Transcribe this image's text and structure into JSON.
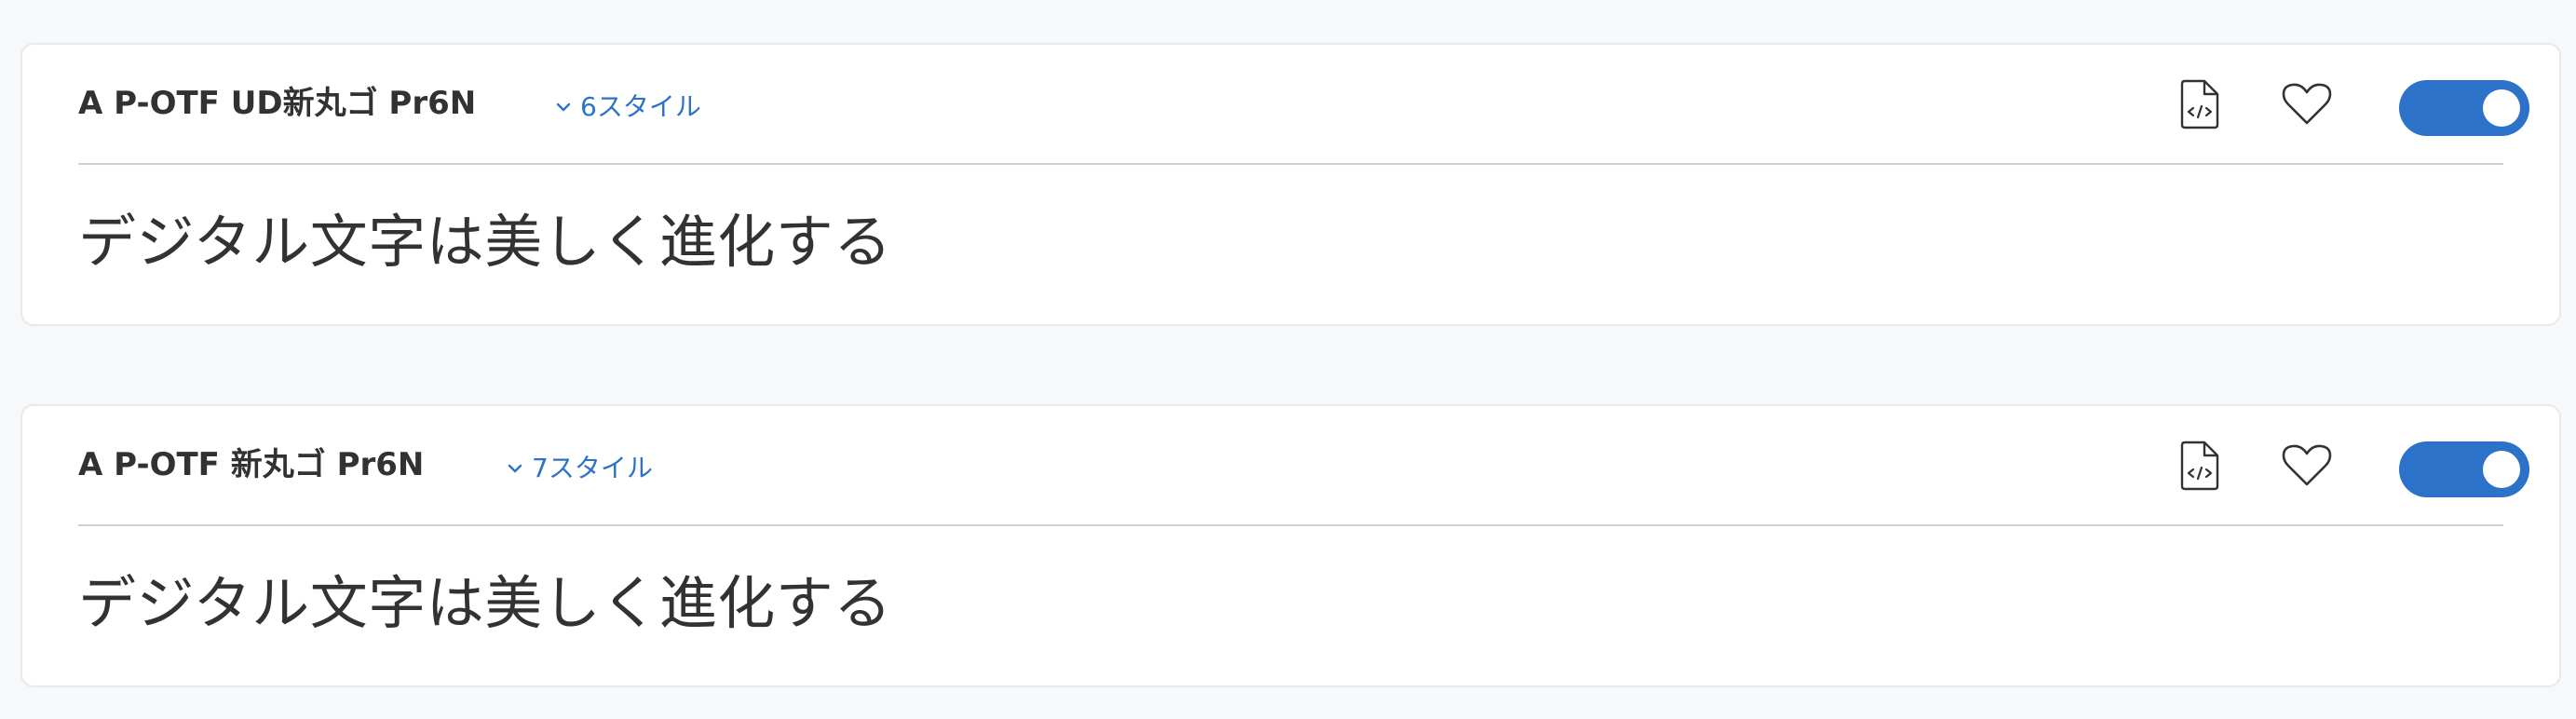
{
  "fonts": [
    {
      "name": "A P-OTF UD新丸ゴ Pr6N",
      "styles_label": "6スタイル",
      "sample_text": "デジタル文字は美しく進化する",
      "enabled": true
    },
    {
      "name": "A P-OTF 新丸ゴ Pr6N",
      "styles_label": "7スタイル",
      "sample_text": "デジタル文字は美しく進化する",
      "enabled": true
    }
  ],
  "icons": {
    "styles_toggle": "chevron-down-icon",
    "embed": "file-code-icon",
    "favorite": "heart-icon"
  },
  "colors": {
    "accent": "#2c72c9",
    "text": "#323232",
    "divider": "#cfd1d4",
    "background": "#f7f8fa",
    "card": "#ffffff"
  }
}
